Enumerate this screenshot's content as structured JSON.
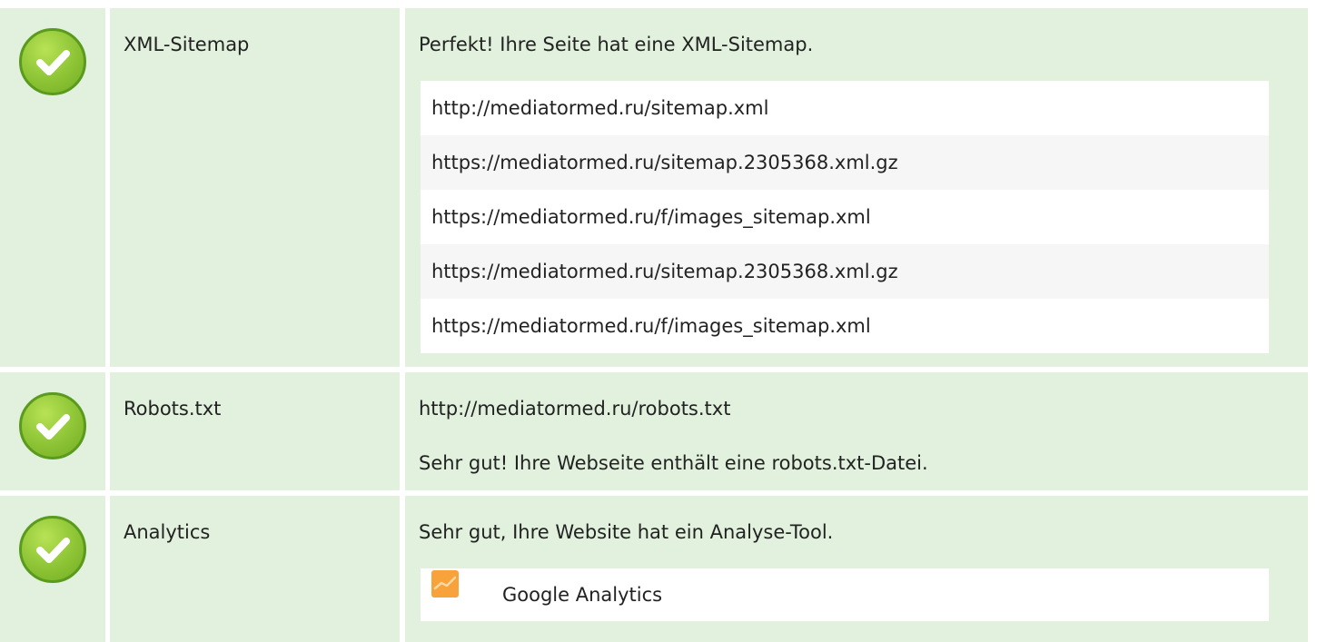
{
  "colors": {
    "row_background": "#e1f1dd",
    "check_green": "#8cc63f",
    "check_border": "#5a9b1e",
    "ga_orange": "#f7a23a"
  },
  "rows": [
    {
      "status_icon": "check-circle-icon",
      "label": "XML-Sitemap",
      "message": "Perfekt! Ihre Seite hat eine XML-Sitemap.",
      "urls": [
        "http://mediatormed.ru/sitemap.xml",
        "https://mediatormed.ru/sitemap.2305368.xml.gz",
        "https://mediatormed.ru/f/images_sitemap.xml",
        "https://mediatormed.ru/sitemap.2305368.xml.gz",
        "https://mediatormed.ru/f/images_sitemap.xml"
      ]
    },
    {
      "status_icon": "check-circle-icon",
      "label": "Robots.txt",
      "robots_url": "http://mediatormed.ru/robots.txt",
      "message": "Sehr gut! Ihre Webseite enthält eine robots.txt-Datei."
    },
    {
      "status_icon": "check-circle-icon",
      "label": "Analytics",
      "message": "Sehr gut, Ihre Website hat ein Analyse-Tool.",
      "tools": [
        {
          "icon": "google-analytics-icon",
          "name": "Google Analytics"
        }
      ]
    }
  ]
}
